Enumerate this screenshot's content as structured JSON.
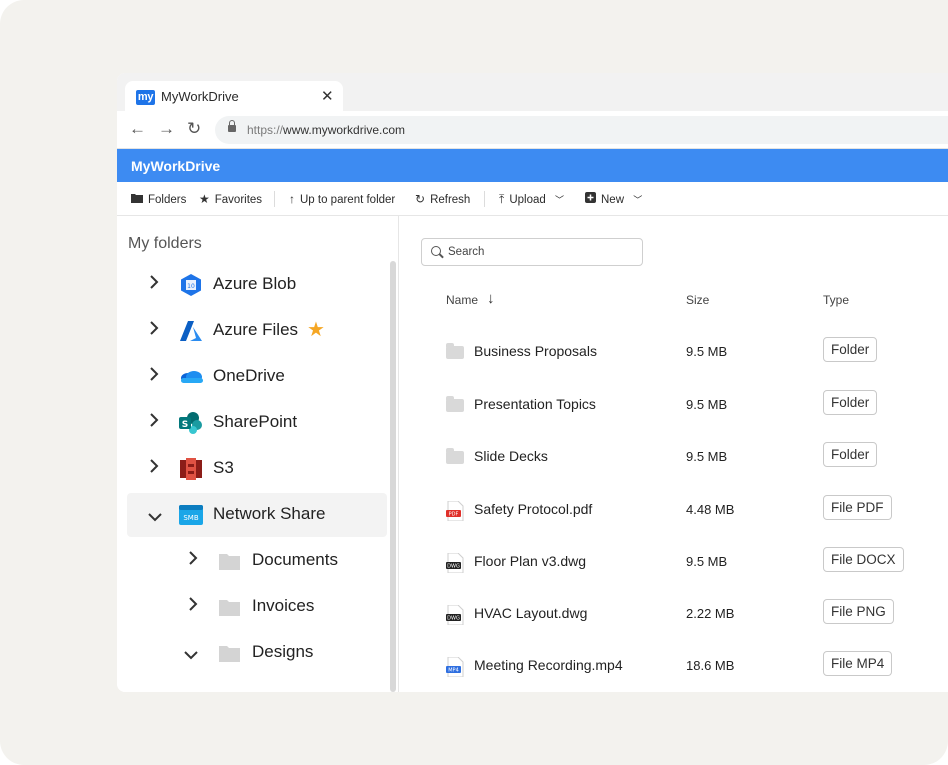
{
  "browser": {
    "tab_title": "MyWorkDrive",
    "tab_logo_text": "my",
    "url_scheme": "https://",
    "url_host": "www.myworkdrive.com"
  },
  "app": {
    "title": "MyWorkDrive"
  },
  "toolbar": {
    "folders": "Folders",
    "favorites": "Favorites",
    "up": "Up to parent folder",
    "refresh": "Refresh",
    "upload": "Upload",
    "new": "New"
  },
  "sidebar": {
    "title": "My folders",
    "items": [
      {
        "label": "Azure Blob",
        "icon": "azure-blob-icon",
        "favorite": false
      },
      {
        "label": "Azure Files",
        "icon": "azure-files-icon",
        "favorite": true
      },
      {
        "label": "OneDrive",
        "icon": "onedrive-icon",
        "favorite": false
      },
      {
        "label": "SharePoint",
        "icon": "sharepoint-icon",
        "favorite": false
      },
      {
        "label": "S3",
        "icon": "s3-icon",
        "favorite": false
      },
      {
        "label": "Network Share",
        "icon": "smb-icon",
        "badge_text": "SMB",
        "expanded": true,
        "selected": true
      },
      {
        "label": "Documents",
        "icon": "folder-icon"
      },
      {
        "label": "Invoices",
        "icon": "folder-icon"
      },
      {
        "label": "Designs",
        "icon": "folder-icon",
        "expanded": true
      }
    ]
  },
  "main": {
    "search_placeholder": "Search",
    "columns": {
      "name": "Name",
      "size": "Size",
      "type": "Type"
    },
    "files": [
      {
        "name": "Business Proposals",
        "size": "9.5 MB",
        "type": "Folder",
        "icon": "folder-icon"
      },
      {
        "name": "Presentation Topics",
        "size": "9.5 MB",
        "type": "Folder",
        "icon": "folder-icon"
      },
      {
        "name": "Slide Decks",
        "size": "9.5 MB",
        "type": "Folder",
        "icon": "folder-icon"
      },
      {
        "name": "Safety Protocol.pdf",
        "size": "4.48 MB",
        "type": "File PDF",
        "icon": "pdf-file-icon",
        "icon_text": "PDF"
      },
      {
        "name": "Floor Plan v3.dwg",
        "size": "9.5 MB",
        "type": "File DOCX",
        "icon": "dwg-file-icon",
        "icon_text": "DWG"
      },
      {
        "name": "HVAC Layout.dwg",
        "size": "2.22 MB",
        "type": "File PNG",
        "icon": "dwg-file-icon",
        "icon_text": "DWG"
      },
      {
        "name": "Meeting Recording.mp4",
        "size": "18.6 MB",
        "type": "File MP4",
        "icon": "mp4-file-icon",
        "icon_text": "MP4"
      }
    ]
  },
  "colors": {
    "accent": "#3d8bf2",
    "star": "#f5a623",
    "pdf": "#e0302a",
    "mp4": "#2f6fe0"
  }
}
